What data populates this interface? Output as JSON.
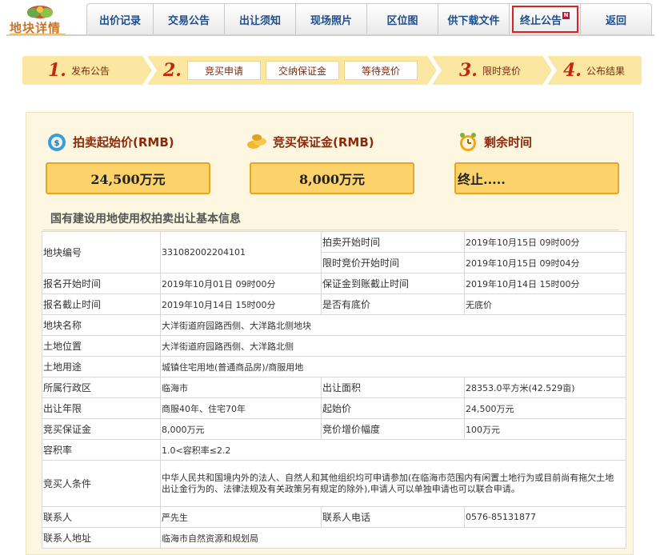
{
  "logo": {
    "title": "地块详情",
    "icon": "leaf-logo-icon"
  },
  "tabs": [
    {
      "label": "出价记录",
      "width": 84
    },
    {
      "label": "交易公告",
      "width": 89
    },
    {
      "label": "出让须知",
      "width": 89
    },
    {
      "label": "现场照片",
      "width": 89
    },
    {
      "label": "区位图",
      "width": 89
    },
    {
      "label": "供下载文件",
      "width": 89
    },
    {
      "label": "终止公告",
      "width": 89,
      "badge": "N",
      "active": true
    },
    {
      "label": "返回",
      "width": 89
    }
  ],
  "steps": {
    "s1": {
      "num": "1.",
      "label": "发布公告"
    },
    "s2": {
      "num": "2.",
      "subs": [
        "竞买申请",
        "交纳保证金",
        "等待竞价"
      ]
    },
    "s3": {
      "num": "3.",
      "label": "限时竞价"
    },
    "s4": {
      "num": "4.",
      "label": "公布结果"
    }
  },
  "stats": {
    "start_price": {
      "label": "拍卖起始价(RMB)",
      "value": "24,500万元",
      "icon": "money-bag-icon"
    },
    "deposit": {
      "label": "竞买保证金(RMB)",
      "value": "8,000万元",
      "icon": "coins-icon"
    },
    "remaining": {
      "label": "剩余时间",
      "value": "终止.....",
      "icon": "alarm-clock-icon"
    }
  },
  "section_title": "国有建设用地使用权拍卖出让基本信息",
  "info": {
    "parcel_no": {
      "k": "地块编号",
      "v": "331082002204101"
    },
    "auction_start": {
      "k": "拍卖开始时间",
      "v": "2019年10月15日 09时00分"
    },
    "timed_bid_start": {
      "k": "限时竞价开始时间",
      "v": "2019年10月15日 09时04分"
    },
    "reg_start": {
      "k": "报名开始时间",
      "v": "2019年10月01日 09时00分"
    },
    "deposit_deadline": {
      "k": "保证金到账截止时间",
      "v": "2019年10月14日 15时00分"
    },
    "reg_end": {
      "k": "报名截止时间",
      "v": "2019年10月14日 15时00分"
    },
    "reserve": {
      "k": "是否有底价",
      "v": "无底价"
    },
    "name": {
      "k": "地块名称",
      "v": "大洋街道府园路西侧、大洋路北侧地块"
    },
    "location": {
      "k": "土地位置",
      "v": "大洋街道府园路西侧、大洋路北侧"
    },
    "usage": {
      "k": "土地用途",
      "v": "城镇住宅用地(普通商品房)/商服用地"
    },
    "district": {
      "k": "所属行政区",
      "v": "临海市"
    },
    "area": {
      "k": "出让面积",
      "v": "28353.0平方米(42.529亩)"
    },
    "term": {
      "k": "出让年限",
      "v": "商服40年、住宅70年"
    },
    "start_price": {
      "k": "起始价",
      "v": "24,500万元"
    },
    "deposit": {
      "k": "竞买保证金",
      "v": "8,000万元"
    },
    "increment": {
      "k": "竞价增价幅度",
      "v": "100万元"
    },
    "far": {
      "k": "容积率",
      "v": "1.0<容积率≤2.2"
    },
    "bidder": {
      "k": "竞买人条件",
      "v": "中华人民共和国境内外的法人、自然人和其他组织均可申请参加(在临海市范围内有闲置土地行为或目前尚有拖欠土地出让金行为的、法律法规及有关政策另有规定的除外),申请人可以单独申请也可以联合申请。"
    },
    "contact": {
      "k": "联系人",
      "v": "严先生"
    },
    "phone": {
      "k": "联系人电话",
      "v": "0576-85131877"
    },
    "address": {
      "k": "联系人地址",
      "v": "临海市自然资源和规划局"
    }
  },
  "colors": {
    "accent": "#fbd36a",
    "tab_text": "#1f4e8c",
    "step_num": "#c0290f",
    "panel_bg": "#fdf7e2"
  }
}
